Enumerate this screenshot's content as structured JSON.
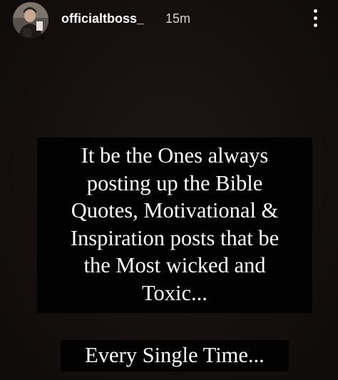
{
  "story": {
    "username": "officialtboss_",
    "timestamp": "15m",
    "more_icon": "more-vertical-icon",
    "caption_lines": [
      "It be the Ones always",
      "posting up the Bible",
      "Quotes, Motivational &",
      "Inspiration posts that be",
      "the Most wicked and",
      "Toxic..."
    ],
    "tagline": "Every Single Time..."
  },
  "colors": {
    "background": "#14100f",
    "text_block": "#030202",
    "text": "#ffffff"
  }
}
